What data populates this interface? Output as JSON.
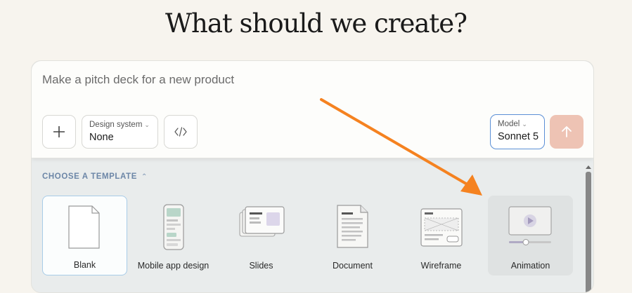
{
  "heading": "What should we create?",
  "prompt": {
    "placeholder": "Make a pitch deck for a new product"
  },
  "toolbar": {
    "add_icon": "plus-icon",
    "design_system": {
      "label": "Design system",
      "value": "None"
    },
    "code_icon": "code-icon",
    "model": {
      "label": "Model",
      "value": "Sonnet 5"
    },
    "send_icon": "arrow-up-icon"
  },
  "templates": {
    "header": "CHOOSE A TEMPLATE",
    "items": [
      {
        "label": "Blank",
        "icon": "blank-page-icon",
        "selected": true
      },
      {
        "label": "Mobile app design",
        "icon": "mobile-phone-icon"
      },
      {
        "label": "Slides",
        "icon": "slides-icon"
      },
      {
        "label": "Document",
        "icon": "document-icon"
      },
      {
        "label": "Wireframe",
        "icon": "wireframe-icon"
      },
      {
        "label": "Animation",
        "icon": "animation-icon",
        "hovered": true
      }
    ]
  },
  "colors": {
    "annotation_arrow": "#f58220",
    "send_button": "#eec3b4",
    "model_border": "#5b8fd6",
    "template_header": "#6c86a7"
  }
}
